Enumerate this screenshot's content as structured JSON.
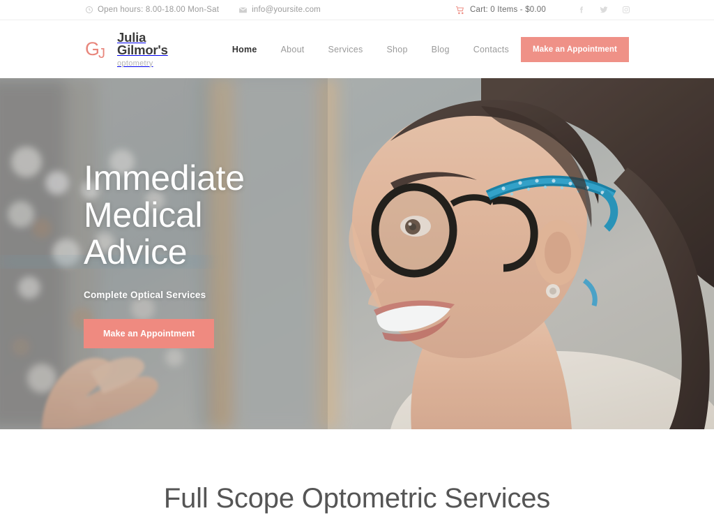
{
  "topbar": {
    "hours_icon": "clock-icon",
    "hours": "Open hours: 8.00-18.00 Mon-Sat",
    "email_icon": "envelope-icon",
    "email": "info@yoursite.com",
    "cart_icon": "shopping-cart-icon",
    "cart_label": "Cart: 0 Items - $0.00",
    "socials": [
      {
        "name": "facebook-icon",
        "glyph": "f"
      },
      {
        "name": "twitter-icon",
        "glyph": "t"
      },
      {
        "name": "instagram-icon",
        "glyph": "i"
      }
    ]
  },
  "brand": {
    "mark": "gj-monogram-logo",
    "name": "Julia Gilmor's",
    "tagline": "optometry"
  },
  "nav": {
    "items": [
      {
        "label": "Home",
        "active": true
      },
      {
        "label": "About",
        "active": false
      },
      {
        "label": "Services",
        "active": false
      },
      {
        "label": "Shop",
        "active": false
      },
      {
        "label": "Blog",
        "active": false
      },
      {
        "label": "Contacts",
        "active": false
      }
    ],
    "cta_label": "Make an Appointment"
  },
  "hero": {
    "heading_line1": "Immediate",
    "heading_line2": "Medical",
    "heading_line3": "Advice",
    "subheading": "Complete Optical Services",
    "cta_label": "Make an Appointment",
    "image_alt": "Smiling woman wearing blue eyeglasses in an optical store"
  },
  "section": {
    "title": "Full Scope Optometric Services"
  },
  "colors": {
    "accent": "#ef9187",
    "hero_cta": "#ef8a80",
    "nav_active": "#333333",
    "nav_inactive": "#9a9a9a",
    "muted_text": "#9b9b9b",
    "section_title": "#555555"
  }
}
